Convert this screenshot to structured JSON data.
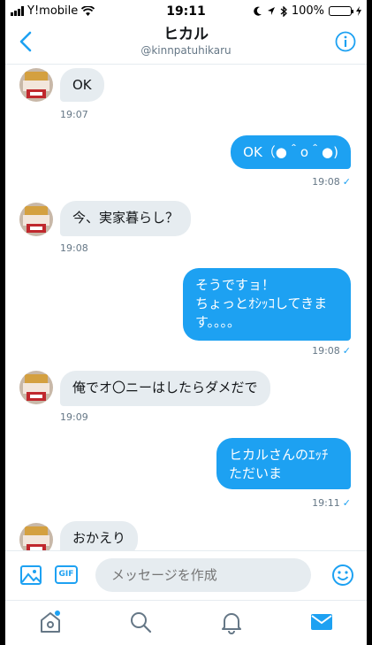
{
  "status_bar": {
    "carrier": "Y!mobile",
    "time": "19:11",
    "battery": "100%"
  },
  "header": {
    "title": "ヒカル",
    "handle": "@kinnpatuhikaru"
  },
  "messages": [
    {
      "side": "in",
      "text": "OK",
      "time": "19:07"
    },
    {
      "side": "out",
      "text": "OK（●＾o＾●)",
      "time": "19:08"
    },
    {
      "side": "in",
      "text": "今、実家暮らし？",
      "time": "19:08"
    },
    {
      "side": "out",
      "lines": [
        "そうですョ！",
        "ちょっとｵｼｯｺしてきま",
        "す。。。。"
      ],
      "time": "19:08"
    },
    {
      "side": "in",
      "text": "俺でオ〇ニーはしたらダメだで",
      "time": "19:09"
    },
    {
      "side": "out",
      "lines": [
        "ヒカルさんのｴｯﾁ",
        "ただいま"
      ],
      "time": "19:11"
    },
    {
      "side": "in",
      "text": "おかえり",
      "time": ""
    }
  ],
  "composer": {
    "gif_label": "GIF",
    "placeholder": "メッセージを作成"
  },
  "tabs": [
    "home-icon",
    "search-icon",
    "notifications-icon",
    "messages-icon"
  ],
  "colors": {
    "accent": "#1da1f2",
    "bubble_in": "#e6ecf0",
    "muted": "#657786"
  }
}
